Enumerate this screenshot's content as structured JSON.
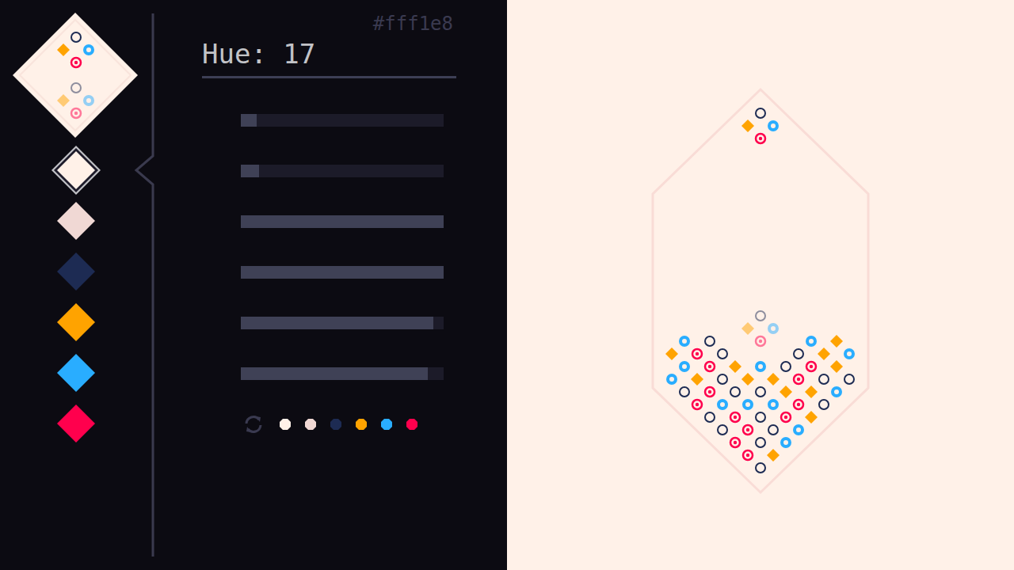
{
  "palette": [
    {
      "color": "#fff1e8",
      "selected": true
    },
    {
      "color": "#f0d8d4",
      "selected": false
    },
    {
      "color": "#1d2b53",
      "selected": false
    },
    {
      "color": "#ffa300",
      "selected": false
    },
    {
      "color": "#29adff",
      "selected": false
    },
    {
      "color": "#ff004d",
      "selected": false
    }
  ],
  "editor": {
    "hex": "#fff1e8",
    "title": "Hue: 17",
    "sliders": [
      {
        "level": 0.08
      },
      {
        "level": 0.09
      },
      {
        "level": 1.0
      },
      {
        "level": 1.0
      },
      {
        "level": 0.95
      },
      {
        "level": 0.92
      }
    ]
  },
  "mini_palette": [
    {
      "color": "#fff1e8"
    },
    {
      "color": "#f0d8d4"
    },
    {
      "color": "#1d2b53"
    },
    {
      "color": "#ffa300"
    },
    {
      "color": "#29adff"
    },
    {
      "color": "#ff004d"
    }
  ],
  "board": {
    "piece": {
      "row": 0,
      "col": 7,
      "colors": [
        2,
        3,
        4,
        5
      ]
    },
    "ghost": {
      "row": 16,
      "col": 7
    },
    "rows": [
      [
        null,
        null,
        null,
        null,
        null,
        null,
        null,
        null,
        null,
        null,
        null,
        null,
        null,
        null,
        null
      ],
      [
        null,
        null,
        null,
        null,
        null,
        null,
        null,
        null,
        null,
        null,
        null,
        null,
        null,
        null,
        null
      ],
      [
        null,
        null,
        null,
        null,
        null,
        null,
        null,
        null,
        null,
        null,
        null,
        null,
        null,
        null,
        null
      ],
      [
        null,
        null,
        null,
        null,
        null,
        null,
        null,
        null,
        null,
        null,
        null,
        null,
        null,
        null,
        null
      ],
      [
        null,
        null,
        null,
        null,
        null,
        null,
        null,
        null,
        null,
        null,
        null,
        null,
        null,
        null,
        null
      ],
      [
        null,
        null,
        null,
        null,
        null,
        null,
        null,
        null,
        null,
        null,
        null,
        null,
        null,
        null,
        null
      ],
      [
        null,
        null,
        null,
        null,
        null,
        null,
        null,
        null,
        null,
        null,
        null,
        null,
        null,
        null,
        null
      ],
      [
        null,
        null,
        null,
        null,
        null,
        null,
        null,
        null,
        null,
        null,
        null,
        null,
        null,
        null,
        null
      ],
      [
        null,
        null,
        null,
        null,
        null,
        null,
        null,
        null,
        null,
        null,
        null,
        null,
        null,
        null,
        null
      ],
      [
        null,
        null,
        null,
        null,
        null,
        null,
        null,
        null,
        null,
        null,
        null,
        null,
        null,
        null,
        null
      ],
      [
        null,
        null,
        null,
        null,
        null,
        null,
        null,
        null,
        null,
        null,
        null,
        null,
        null,
        null,
        null
      ],
      [
        null,
        null,
        null,
        null,
        null,
        null,
        null,
        null,
        null,
        null,
        null,
        null,
        null,
        null,
        null
      ],
      [
        null,
        null,
        null,
        null,
        null,
        null,
        null,
        null,
        null,
        null,
        null,
        null,
        null,
        null,
        null
      ],
      [
        null,
        null,
        null,
        null,
        null,
        null,
        null,
        null,
        null,
        null,
        null,
        null,
        null,
        null,
        null
      ],
      [
        null,
        null,
        null,
        null,
        null,
        null,
        null,
        null,
        null,
        null,
        null,
        null,
        null,
        null,
        null
      ],
      [
        null,
        null,
        null,
        null,
        null,
        null,
        null,
        null,
        null,
        null,
        null,
        null,
        null,
        null,
        null
      ],
      [
        null,
        null,
        null,
        null,
        null,
        null,
        null,
        null,
        null,
        null,
        null,
        null,
        null,
        null,
        null
      ],
      [
        null,
        null,
        null,
        null,
        null,
        null,
        null,
        null,
        null,
        null,
        null,
        null,
        null,
        null,
        null
      ],
      [
        null,
        4,
        null,
        2,
        null,
        null,
        null,
        null,
        null,
        null,
        null,
        4,
        null,
        3,
        null
      ],
      [
        3,
        null,
        5,
        null,
        2,
        null,
        null,
        null,
        null,
        null,
        2,
        null,
        3,
        null,
        4
      ],
      [
        null,
        4,
        null,
        5,
        null,
        3,
        null,
        4,
        null,
        2,
        null,
        5,
        null,
        3,
        null
      ],
      [
        4,
        null,
        3,
        null,
        2,
        null,
        3,
        null,
        3,
        null,
        5,
        null,
        2,
        null,
        2
      ],
      [
        null,
        2,
        null,
        5,
        null,
        2,
        null,
        2,
        null,
        3,
        null,
        3,
        null,
        4,
        null
      ],
      [
        null,
        null,
        5,
        null,
        4,
        null,
        4,
        null,
        4,
        null,
        5,
        null,
        2,
        null,
        null
      ],
      [
        null,
        null,
        null,
        2,
        null,
        5,
        null,
        2,
        null,
        5,
        null,
        3,
        null,
        null,
        null
      ],
      [
        null,
        null,
        null,
        null,
        2,
        null,
        5,
        null,
        2,
        null,
        4,
        null,
        null,
        null,
        null
      ],
      [
        null,
        null,
        null,
        null,
        null,
        5,
        null,
        2,
        null,
        4,
        null,
        null,
        null,
        null,
        null
      ],
      [
        null,
        null,
        null,
        null,
        null,
        null,
        5,
        null,
        3,
        null,
        null,
        null,
        null,
        null,
        null
      ],
      [
        null,
        null,
        null,
        null,
        null,
        null,
        null,
        2,
        null,
        null,
        null,
        null,
        null,
        null,
        null
      ]
    ]
  }
}
